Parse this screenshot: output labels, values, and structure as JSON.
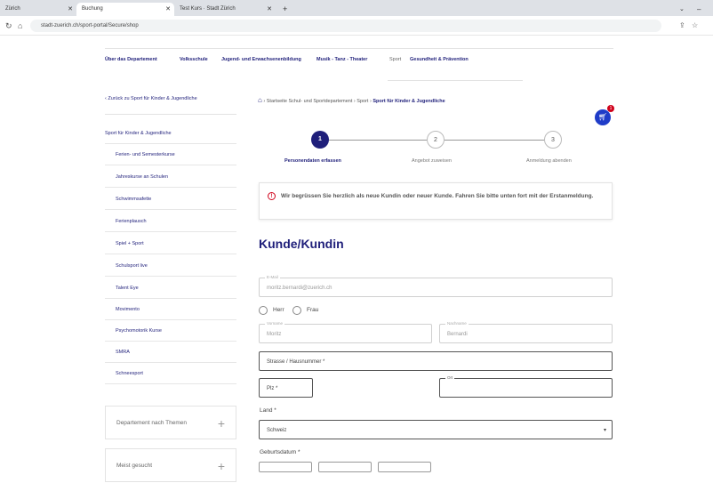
{
  "browser": {
    "tabs": [
      {
        "label": "Zürich"
      },
      {
        "label": "Buchung"
      },
      {
        "label": "Test Kurs · Stadt Zürich"
      }
    ],
    "new_tab": "+",
    "url": "stadt-zuerich.ch/sport-portal/Secure/shop"
  },
  "topnav": {
    "items": [
      "Über das Departement",
      "Volksschule",
      "Jugend- und Erwachsenenbildung",
      "Musik - Tanz - Theater",
      "Sport",
      "Gesundheit & Prävention"
    ]
  },
  "sidebar": {
    "back": "‹  Zurück zu Sport für Kinder & Jugendliche",
    "section": "Sport für Kinder & Jugendliche",
    "items": [
      "Ferien- und Semesterkurse",
      "Jahreskurse an Schulen",
      "Schwimmsafette",
      "Ferienplausch",
      "Spiel + Sport",
      "Schulsport live",
      "Talent Eye",
      "Movimento",
      "Psychomotorik Kurse",
      "SMRA",
      "Schneesport"
    ],
    "boxes": [
      "Departement nach Themen",
      "Meist gesucht"
    ]
  },
  "breadcrumb": {
    "parts": [
      "Startseite Schul- und Sportdepartement",
      "Sport",
      "Sport für Kinder & Jugendliche"
    ]
  },
  "cart": {
    "count": "1"
  },
  "steps": [
    {
      "number": "1",
      "label": "Personendaten erfassen"
    },
    {
      "number": "2",
      "label": "Angebot zuweisen"
    },
    {
      "number": "3",
      "label": "Anmeldung abenden"
    }
  ],
  "notice": {
    "icon": "!",
    "text": "Wir begrüssen Sie herzlich als neue Kundin oder neuer Kunde. Fahren Sie bitte unten fort mit der Erstanmeldung."
  },
  "form": {
    "heading": "Kunde/Kundin",
    "email_label": "E-Mail",
    "email_value": "moritz.bernardi@zuerich.ch",
    "salutation_options": [
      "Herr",
      "Frau"
    ],
    "firstname_label": "Vorname",
    "firstname_value": "Moritz",
    "lastname_label": "Nachname",
    "lastname_value": "Bernardi",
    "street_placeholder": "Strasse / Hausnummer *",
    "plz_placeholder": "Plz *",
    "ort_label": "Ort",
    "land_label": "Land *",
    "land_value": "Schweiz",
    "birth_label": "Geburtsdatum *"
  }
}
